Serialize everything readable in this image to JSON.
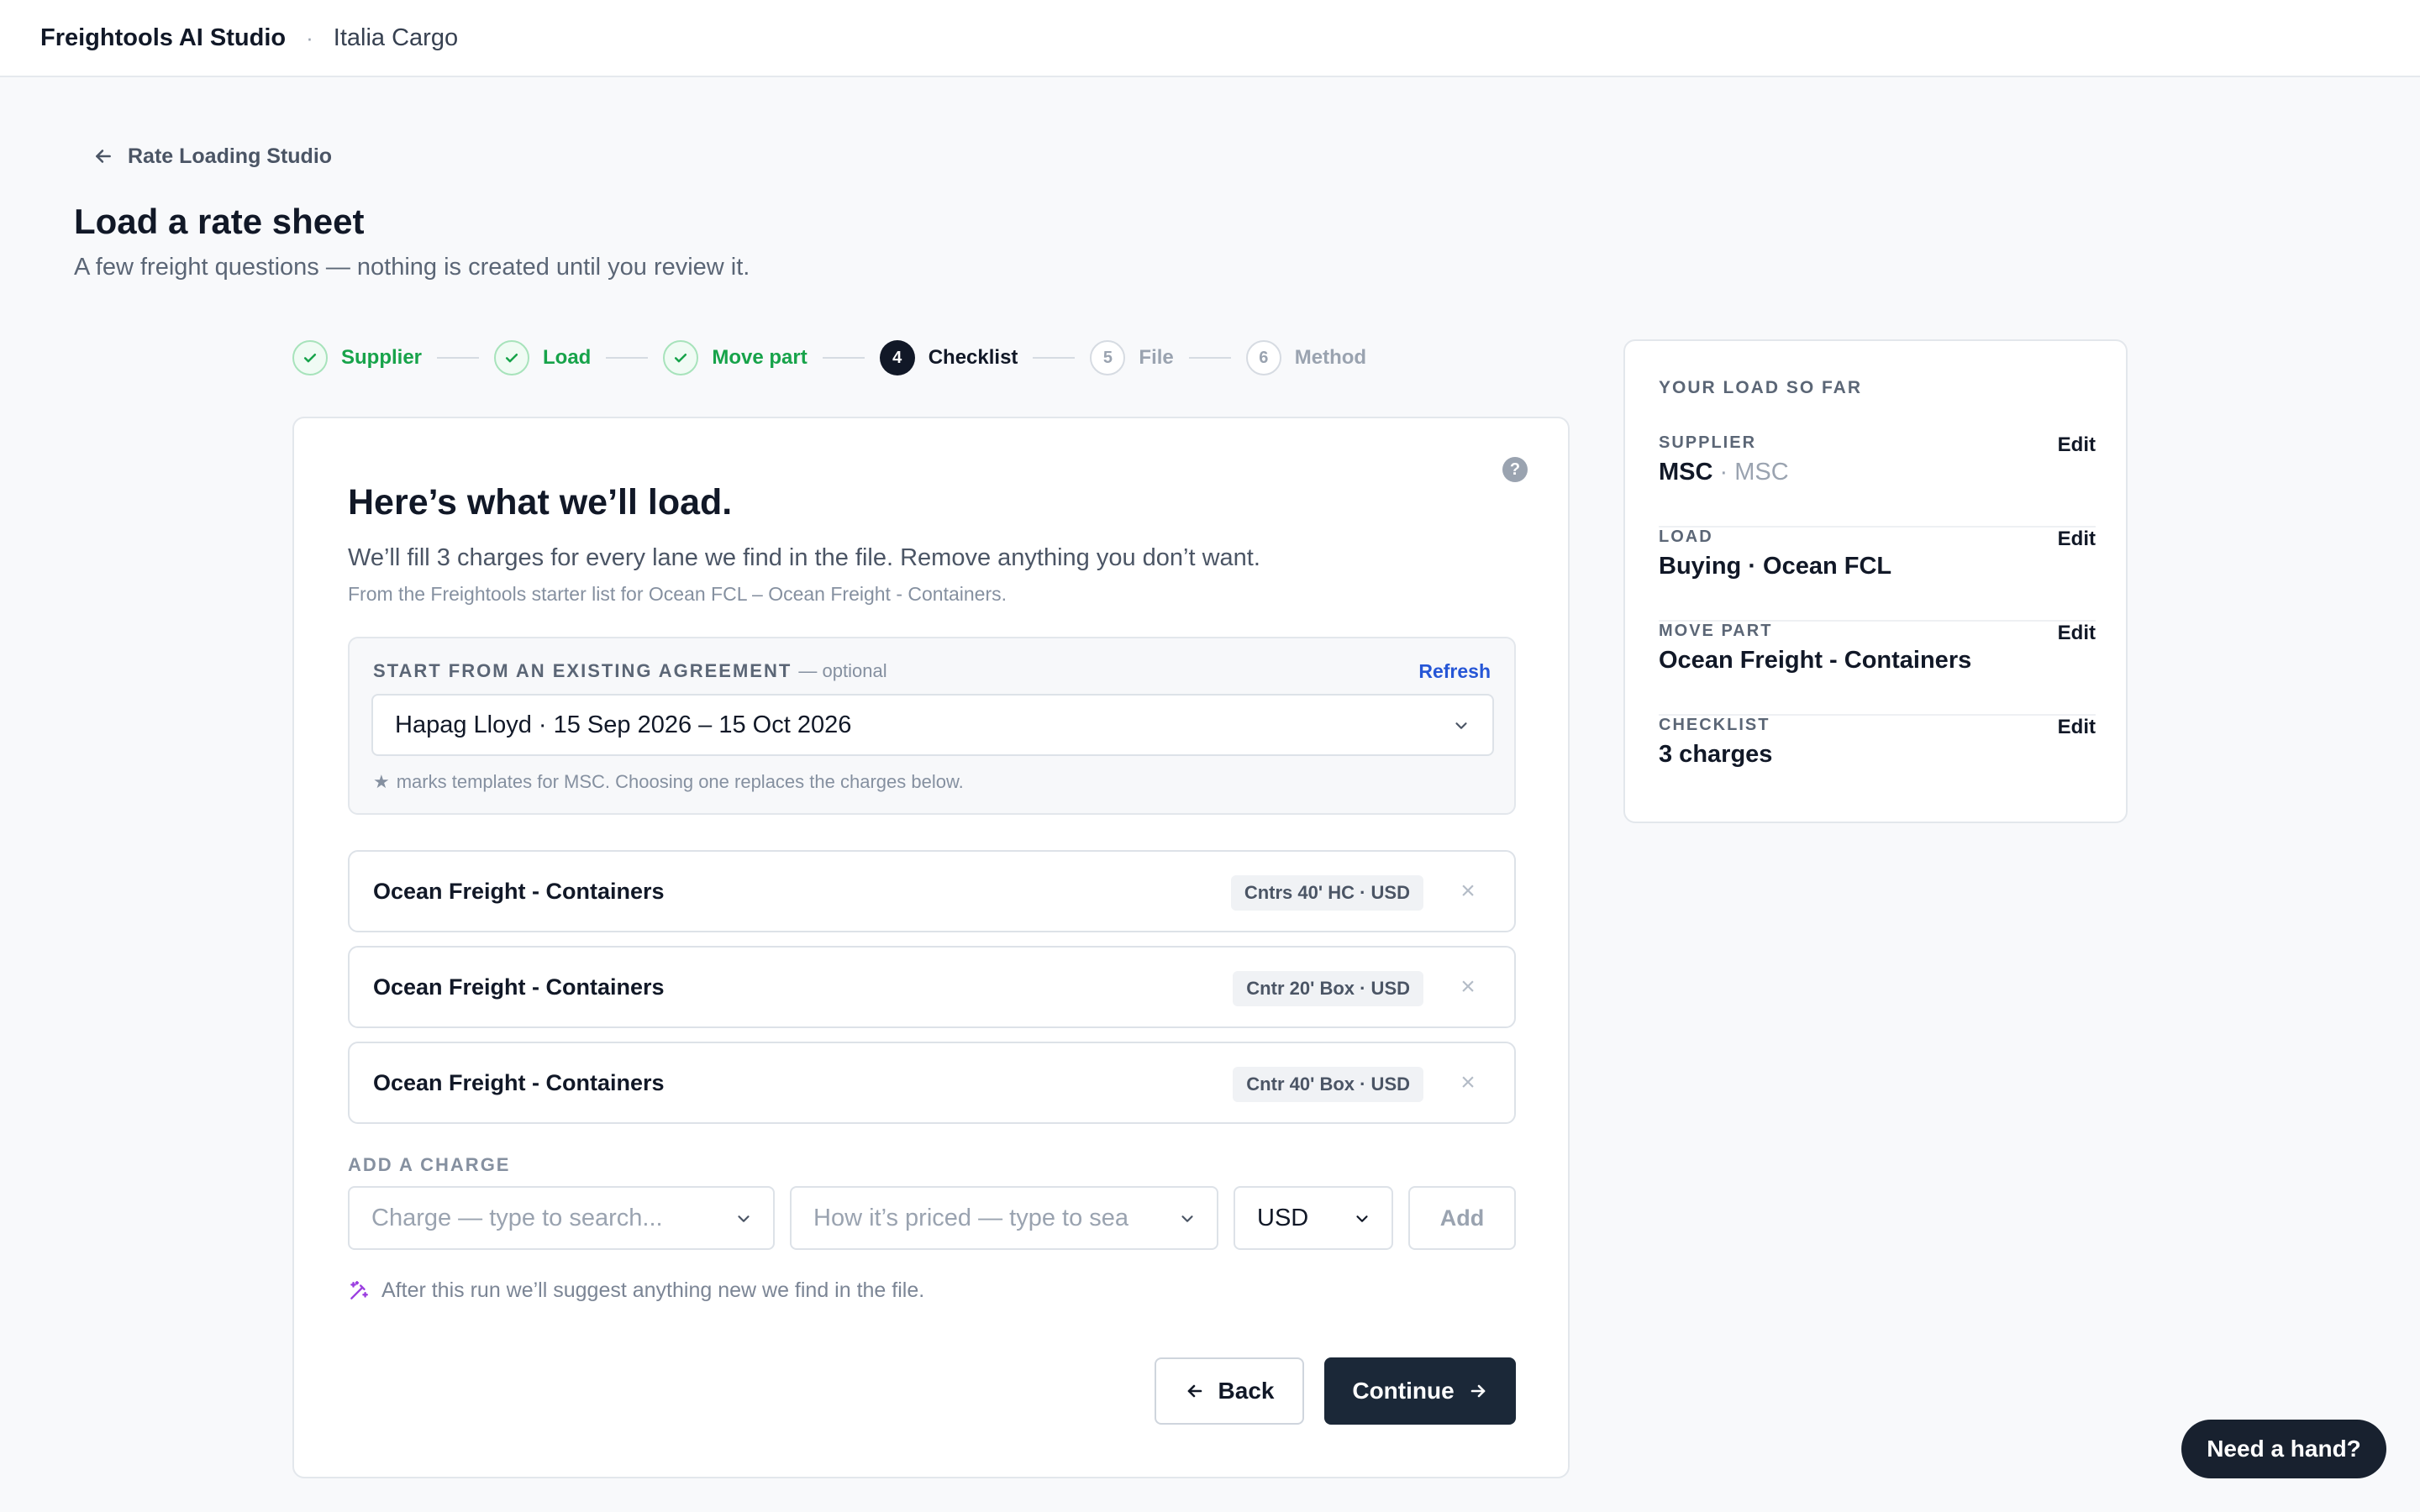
{
  "header": {
    "app_name": "Freightools AI Studio",
    "separator": "·",
    "workspace": "Italia Cargo"
  },
  "breadcrumb": {
    "back_label": "Rate Loading Studio"
  },
  "page": {
    "title": "Load a rate sheet",
    "subtitle": "A few freight questions — nothing is created until you review it."
  },
  "stepper": {
    "steps": [
      {
        "label": "Supplier",
        "status": "done"
      },
      {
        "label": "Load",
        "status": "done"
      },
      {
        "label": "Move part",
        "status": "done"
      },
      {
        "label": "Checklist",
        "number": "4",
        "status": "current"
      },
      {
        "label": "File",
        "number": "5",
        "status": "todo"
      },
      {
        "label": "Method",
        "number": "6",
        "status": "todo"
      }
    ]
  },
  "checklist": {
    "help_glyph": "?",
    "title": "Here’s what we’ll load.",
    "lead": "We’ll fill 3 charges for every lane we find in the file. Remove anything you don’t want.",
    "note": "From the Freightools starter list for Ocean FCL – Ocean Freight - Containers.",
    "agreement": {
      "label": "START FROM AN EXISTING AGREEMENT",
      "optional": "— optional",
      "refresh_label": "Refresh",
      "selected": "Hapag Lloyd · 15 Sep 2026 – 15 Oct 2026",
      "hint": "marks templates for MSC. Choosing one replaces the charges below."
    },
    "charges": [
      {
        "name": "Ocean Freight - Containers",
        "tag": "Cntrs 40' HC · USD"
      },
      {
        "name": "Ocean Freight - Containers",
        "tag": "Cntr 20' Box · USD"
      },
      {
        "name": "Ocean Freight - Containers",
        "tag": "Cntr 40' Box · USD"
      }
    ],
    "remove_glyph": "×",
    "add": {
      "label": "ADD A CHARGE",
      "charge_placeholder": "Charge — type to search...",
      "pricing_placeholder": "How it’s priced — type to sea",
      "currency": "USD",
      "add_label": "Add"
    },
    "suggest_text": "After this run we’ll suggest anything new we find in the file.",
    "back_label": "Back",
    "continue_label": "Continue"
  },
  "summary": {
    "heading": "YOUR LOAD SO FAR",
    "edit_label": "Edit",
    "items": [
      {
        "label": "SUPPLIER",
        "value": "MSC",
        "secondary": "· MSC"
      },
      {
        "label": "LOAD",
        "value": "Buying · Ocean FCL"
      },
      {
        "label": "MOVE PART",
        "value": "Ocean Freight - Containers"
      },
      {
        "label": "CHECKLIST",
        "value": "3 charges"
      }
    ]
  },
  "help_button": {
    "label": "Need a hand?"
  },
  "colors": {
    "success": "#17a34a",
    "primary_dark": "#1b2838",
    "link_blue": "#2656d6",
    "magic_purple": "#9b3ee0"
  }
}
